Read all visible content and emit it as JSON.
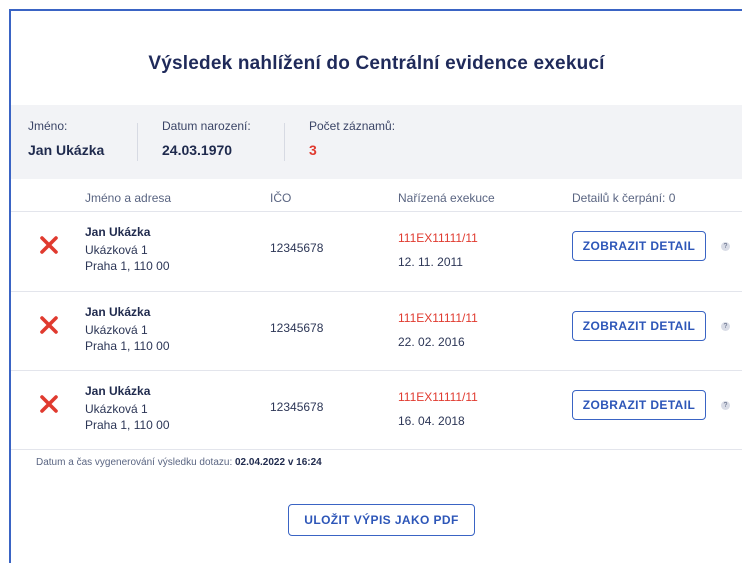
{
  "title": "Výsledek nahlížení do Centrální evidence exekucí",
  "summary": {
    "name_label": "Jméno:",
    "name_value": "Jan Ukázka",
    "birth_label": "Datum narození:",
    "birth_value": "24.03.1970",
    "count_label": "Počet záznamů:",
    "count_value": "3"
  },
  "table": {
    "headers": [
      "Jméno a adresa",
      "IČO",
      "Nařízená exekuce",
      "Detailů k čerpání: 0"
    ],
    "rows": [
      {
        "name": "Jan Ukázka",
        "street": "Ukázková 1",
        "city": "Praha 1, 110 00",
        "ico": "12345678",
        "case": "111EX11111/11",
        "date": "12. 11. 2011",
        "button": "ZOBRAZIT DETAIL",
        "help": "?"
      },
      {
        "name": "Jan Ukázka",
        "street": "Ukázková 1",
        "city": "Praha 1, 110 00",
        "ico": "12345678",
        "case": "111EX11111/11",
        "date": "22. 02. 2016",
        "button": "ZOBRAZIT DETAIL",
        "help": "?"
      },
      {
        "name": "Jan Ukázka",
        "street": "Ukázková 1",
        "city": "Praha 1, 110 00",
        "ico": "12345678",
        "case": "111EX11111/11",
        "date": "16. 04. 2018",
        "button": "ZOBRAZIT DETAIL",
        "help": "?"
      }
    ]
  },
  "footer": {
    "generated_label": "Datum a čas vygenerování výsledku dotazu:",
    "generated_value": "02.04.2022 v 16:24",
    "pdf_button": "ULOŽIT VÝPIS JAKO PDF"
  },
  "icons": {
    "row_status": "close-x-icon",
    "help": "help-icon"
  },
  "colors": {
    "accent": "#3a64c4",
    "status_red": "#e03a2f",
    "heading": "#1f2a5a"
  }
}
